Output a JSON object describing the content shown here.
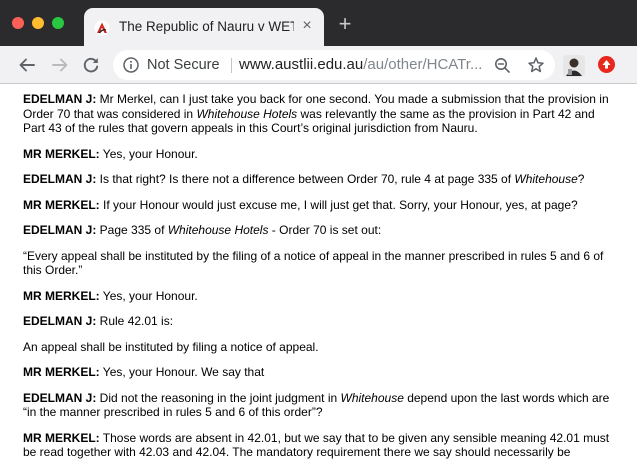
{
  "window": {
    "tab_title": "The Republic of Nauru v WETO",
    "tab_close": "×",
    "new_tab": "+",
    "colors": {
      "tabstrip": "#2b2b2d",
      "toolbar": "#f1f1f3",
      "update_badge": "#e8281f"
    }
  },
  "toolbar": {
    "security_label": "Not Secure",
    "url_host": "www.austlii.edu.au",
    "url_path": "/au/other/HCATr..."
  },
  "icons": [
    "austlii-favicon",
    "back-arrow-icon",
    "forward-arrow-icon",
    "reload-icon",
    "info-icon",
    "zoom-out-icon",
    "star-icon",
    "profile-avatar",
    "update-icon"
  ],
  "transcript": [
    {
      "speaker": "EDELMAN J:",
      "segments": [
        {
          "text": " Mr Merkel, can I just take you back for one second. You made a submission that the provision in Order 70 that was considered in ",
          "italic": false
        },
        {
          "text": "Whitehouse Hotels",
          "italic": true
        },
        {
          "text": " was relevantly the same as the provision in Part 42 and Part 43 of the rules that govern appeals in this Court’s original jurisdiction from Nauru.",
          "italic": false
        }
      ]
    },
    {
      "speaker": "MR MERKEL:",
      "segments": [
        {
          "text": " Yes, your Honour.",
          "italic": false
        }
      ]
    },
    {
      "speaker": "EDELMAN J:",
      "segments": [
        {
          "text": " Is that right? Is there not a difference between Order 70, rule 4 at page 335 of ",
          "italic": false
        },
        {
          "text": "Whitehouse",
          "italic": true
        },
        {
          "text": "?",
          "italic": false
        }
      ]
    },
    {
      "speaker": "MR MERKEL:",
      "segments": [
        {
          "text": " If your Honour would just excuse me, I will just get that. Sorry, your Honour, yes, at page?",
          "italic": false
        }
      ]
    },
    {
      "speaker": "EDELMAN J:",
      "segments": [
        {
          "text": " Page 335 of ",
          "italic": false
        },
        {
          "text": "Whitehouse Hotels",
          "italic": true
        },
        {
          "text": " - Order 70 is set out:",
          "italic": false
        }
      ]
    },
    {
      "speaker": "",
      "segments": [
        {
          "text": "“Every appeal shall be instituted by the filing of a notice of appeal in the manner prescribed in rules 5 and 6 of this Order.”",
          "italic": false
        }
      ]
    },
    {
      "speaker": "MR MERKEL:",
      "segments": [
        {
          "text": " Yes, your Honour.",
          "italic": false
        }
      ]
    },
    {
      "speaker": "EDELMAN J:",
      "segments": [
        {
          "text": " Rule 42.01 is:",
          "italic": false
        }
      ]
    },
    {
      "speaker": "",
      "segments": [
        {
          "text": "An appeal shall be instituted by filing a notice of appeal.",
          "italic": false
        }
      ]
    },
    {
      "speaker": "MR MERKEL:",
      "segments": [
        {
          "text": " Yes, your Honour. We say that",
          "italic": false
        }
      ]
    },
    {
      "speaker": "EDELMAN J:",
      "segments": [
        {
          "text": " Did not the reasoning in the joint judgment in ",
          "italic": false
        },
        {
          "text": "Whitehouse",
          "italic": true
        },
        {
          "text": " depend upon the last words which are “in the manner prescribed in rules 5 and 6 of this order”?",
          "italic": false
        }
      ]
    },
    {
      "speaker": "MR MERKEL:",
      "segments": [
        {
          "text": " Those words are absent in 42.01, but we say that to be given any sensible meaning 42.01 must be read together with 42.03 and 42.04. The mandatory requirement there we say should necessarily be",
          "italic": false
        }
      ]
    }
  ]
}
